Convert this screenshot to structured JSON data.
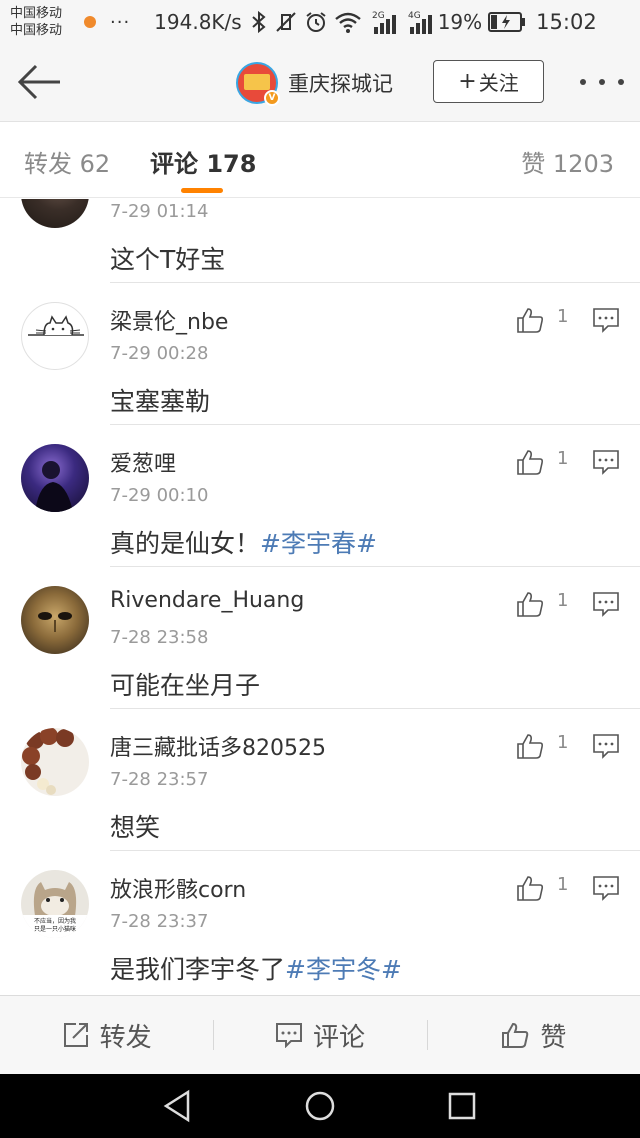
{
  "status_bar": {
    "carrier_1": "中国移动",
    "carrier_2": "中国移动",
    "dots": "···",
    "speed": "194.8K/s",
    "network_2g": "2G",
    "network_4g": "4G",
    "battery": "19%",
    "time": "15:02"
  },
  "nav": {
    "account_name": "重庆探城记",
    "follow_plus": "+",
    "follow_label": "关注",
    "avatar_badge": "V"
  },
  "tabs": {
    "reposts": "转发 62",
    "comments": "评论 178",
    "likes": "赞 1203"
  },
  "comments": [
    {
      "name": "",
      "time": "7-29 01:14",
      "text": "这个T好宝",
      "topic": "",
      "likes": "",
      "avatar": "dark-avatar"
    },
    {
      "name": "梁景伦_nbe",
      "time": "7-29 00:28",
      "text": "宝塞塞勒",
      "topic": "",
      "likes": "1",
      "avatar": "cat-line-drawing-avatar"
    },
    {
      "name": "爱葱哩",
      "time": "7-29 00:10",
      "text": "真的是仙女！",
      "topic": "#李宇春#",
      "likes": "1",
      "avatar": "purple-portrait-avatar"
    },
    {
      "name": "Rivendare_Huang",
      "time": "7-28 23:58",
      "text": "可能在坐月子",
      "topic": "",
      "likes": "1",
      "avatar": "golden-mask-avatar"
    },
    {
      "name": "唐三藏批话多820525",
      "time": "7-28 23:57",
      "text": "想笑",
      "topic": "",
      "likes": "1",
      "avatar": "prayer-beads-avatar"
    },
    {
      "name": "放浪形骸corn",
      "time": "7-28 23:37",
      "text": "是我们李宇冬了",
      "topic": "#李宇冬#",
      "likes": "1",
      "avatar": "cat-meme-avatar",
      "avatar_caption_1": "不应当，因为我",
      "avatar_caption_2": "只是一只小猫咪"
    }
  ],
  "actions": {
    "repost": "转发",
    "comment": "评论",
    "like": "赞"
  },
  "colors": {
    "accent": "#ff8200",
    "topic_link": "#4d7bb5",
    "follow_border": "#555555"
  }
}
